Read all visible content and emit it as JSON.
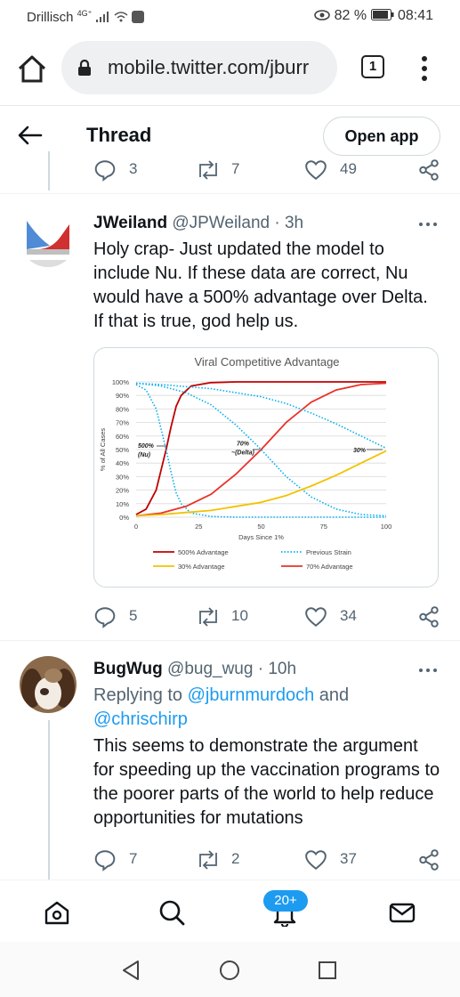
{
  "status_bar": {
    "carrier": "Drillisch",
    "network": "4G⁺",
    "battery": "82 %",
    "time": "08:41"
  },
  "browser": {
    "url": "mobile.twitter.com/jburr",
    "tab_count": "1"
  },
  "header": {
    "title": "Thread",
    "open_app_label": "Open app"
  },
  "previous_tweet": {
    "replies": "3",
    "retweets": "7",
    "likes": "49"
  },
  "tweets": [
    {
      "name": "JWeiland",
      "handle": "@JPWeiland · 3h",
      "text": "Holy crap-  Just updated the model to include Nu.  If these data are correct, Nu would have a 500% advantage over Delta.  If that is true, god help us.",
      "replies": "5",
      "retweets": "10",
      "likes": "34"
    },
    {
      "name": "BugWug",
      "handle": "@bug_wug · 10h",
      "reply_prefix": "Replying to ",
      "mention1": "@jburnmurdoch",
      "reply_and": " and",
      "mention2": "@chrischirp",
      "text": "This seems to demonstrate the argument for speeding up the vaccination programs to the poorer parts of the world to help reduce opportunities for mutations",
      "replies": "7",
      "retweets": "2",
      "likes": "37"
    }
  ],
  "chart_data": {
    "type": "line",
    "title": "Viral Competitive Advantage",
    "xlabel": "Days Since 1%",
    "ylabel": "% of All Cases",
    "xlim": [
      0,
      100
    ],
    "ylim": [
      0,
      100
    ],
    "x_ticks": [
      "0",
      "25",
      "50",
      "75",
      "100"
    ],
    "y_ticks": [
      "0%",
      "10%",
      "20%",
      "30%",
      "40%",
      "50%",
      "60%",
      "70%",
      "80%",
      "90%",
      "100%"
    ],
    "grid": true,
    "legend_position": "bottom",
    "annotations": [
      "500%\n(Nu)",
      "70%\n~(Delta)",
      "30%"
    ],
    "series": [
      {
        "name": "500% Advantage",
        "color": "#c00000",
        "style": "solid",
        "x": [
          0,
          4,
          8,
          10,
          12,
          14,
          16,
          18,
          22,
          30,
          40,
          100
        ],
        "y": [
          2,
          6,
          20,
          35,
          50,
          67,
          82,
          90,
          97,
          99.5,
          100,
          100
        ]
      },
      {
        "name": "Previous Strain (500%)",
        "color": "#00b0f0",
        "style": "dotted",
        "x": [
          0,
          4,
          8,
          10,
          12,
          14,
          16,
          18,
          22,
          30,
          40,
          100
        ],
        "y": [
          98,
          94,
          80,
          65,
          50,
          33,
          18,
          10,
          3,
          0.5,
          0,
          0
        ]
      },
      {
        "name": "70% Advantage",
        "color": "#e8332a",
        "style": "solid",
        "x": [
          0,
          10,
          20,
          30,
          40,
          50,
          60,
          70,
          80,
          90,
          100
        ],
        "y": [
          1,
          3,
          8,
          17,
          32,
          50,
          70,
          85,
          94,
          98,
          99
        ]
      },
      {
        "name": "Previous Strain (70%)",
        "color": "#00b0f0",
        "style": "dotted",
        "x": [
          0,
          10,
          20,
          30,
          40,
          50,
          60,
          70,
          80,
          90,
          100
        ],
        "y": [
          99,
          97,
          92,
          83,
          68,
          50,
          30,
          15,
          6,
          2,
          1
        ]
      },
      {
        "name": "30% Advantage",
        "color": "#f2c200",
        "style": "solid",
        "x": [
          0,
          10,
          20,
          30,
          40,
          50,
          60,
          70,
          80,
          90,
          100
        ],
        "y": [
          1,
          2,
          3.5,
          5,
          8,
          11,
          16,
          23,
          31,
          40,
          49
        ]
      },
      {
        "name": "Previous Strain (30%)",
        "color": "#00b0f0",
        "style": "dotted",
        "x": [
          0,
          10,
          20,
          30,
          40,
          50,
          60,
          70,
          80,
          90,
          100
        ],
        "y": [
          99,
          98,
          96.5,
          95,
          92,
          89,
          84,
          77,
          69,
          60,
          51
        ]
      }
    ],
    "legend": [
      {
        "label": "500% Advantage",
        "color": "#c00000",
        "style": "solid"
      },
      {
        "label": "Previous Strain",
        "color": "#00b0f0",
        "style": "dotted"
      },
      {
        "label": "30% Advantage",
        "color": "#f2c200",
        "style": "solid"
      },
      {
        "label": "70% Advantage",
        "color": "#e8332a",
        "style": "solid"
      }
    ]
  },
  "bottom_nav": {
    "notifications_badge": "20+"
  }
}
